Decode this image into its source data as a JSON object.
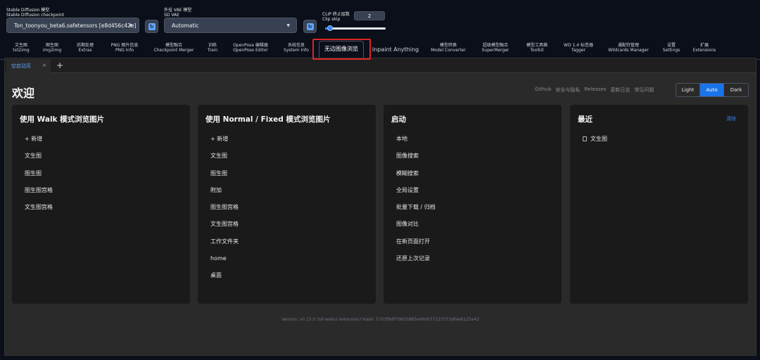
{
  "settings": {
    "checkpoint": {
      "label_cn": "Stable Diffusion 模型",
      "label_en": "Stable Diffusion checkpoint",
      "value": "Ton_toonyou_beta6.safetensors [e8d456c42e]"
    },
    "vae": {
      "label_cn": "外挂 VAE 模型",
      "label_en": "SD VAE",
      "value": "Automatic"
    },
    "clip_skip": {
      "label_cn": "CLIP 终止层数",
      "label_en": "Clip skip",
      "value": "2",
      "fraction": 0.08
    }
  },
  "tabs": [
    {
      "line1": "文生图",
      "line2": "txt2img"
    },
    {
      "line1": "图生图",
      "line2": "img2img"
    },
    {
      "line1": "后期处理",
      "line2": "Extras"
    },
    {
      "line1": "PNG 图片信息",
      "line2": "PNG Info"
    },
    {
      "line1": "模型融合",
      "line2": "Checkpoint Merger"
    },
    {
      "line1": "训练",
      "line2": "Train"
    },
    {
      "line1": "OpenPose 编辑器",
      "line2": "OpenPose Editor"
    },
    {
      "line1": "系统信息",
      "line2": "System Info"
    },
    {
      "line1": "无边图像浏览",
      "line2": ""
    },
    {
      "line1": "Inpaint Anything",
      "line2": ""
    },
    {
      "line1": "模型转换",
      "line2": "Model Converter"
    },
    {
      "line1": "超级模型融合",
      "line2": "SuperMerger"
    },
    {
      "line1": "模型工具箱",
      "line2": "Toolkit"
    },
    {
      "line1": "WD 1.4 标签器",
      "line2": "Tagger"
    },
    {
      "line1": "通配符管理",
      "line2": "Wildcards Manager"
    },
    {
      "line1": "设置",
      "line2": "Settings"
    },
    {
      "line1": "扩展",
      "line2": "Extensions"
    }
  ],
  "subtab": {
    "label": "空启动页",
    "close": "×",
    "add": "+"
  },
  "page": {
    "title": "欢迎",
    "links": [
      "Github",
      "安全与隐私",
      "Releases",
      "更新日志",
      "常见问题"
    ],
    "themes": [
      {
        "label": "Light"
      },
      {
        "label": "Auto"
      },
      {
        "label": "Dark"
      }
    ],
    "active_theme": "Auto"
  },
  "cards": {
    "walk": {
      "title": "使用 Walk 模式浏览图片",
      "items": [
        "+ 新增",
        "文生图",
        "图生图",
        "图生图宫格",
        "文生图宫格"
      ]
    },
    "normal": {
      "title": "使用 Normal / Fixed 模式浏览图片",
      "items": [
        "+ 新增",
        "文生图",
        "图生图",
        "附加",
        "图生图宫格",
        "文生图宫格",
        "工作文件夹",
        "home",
        "桌面"
      ]
    },
    "launch": {
      "title": "启动",
      "items": [
        "本地",
        "图像搜索",
        "模糊搜索",
        "全局设置",
        "批量下载 / 归档",
        "图像对比",
        "在新页面打开",
        "还原上次记录"
      ]
    },
    "recent": {
      "title": "最近",
      "clear": "清除",
      "items": [
        "文生图"
      ]
    }
  },
  "footer": "Version: v0.15.0 (sd-webui extension)    Hash: 5703f9df70835885e060037223753dfee6125e42",
  "colors": {
    "accent": "#1a73e8",
    "link": "#3b82f6",
    "highlight_box": "#dc2626"
  }
}
